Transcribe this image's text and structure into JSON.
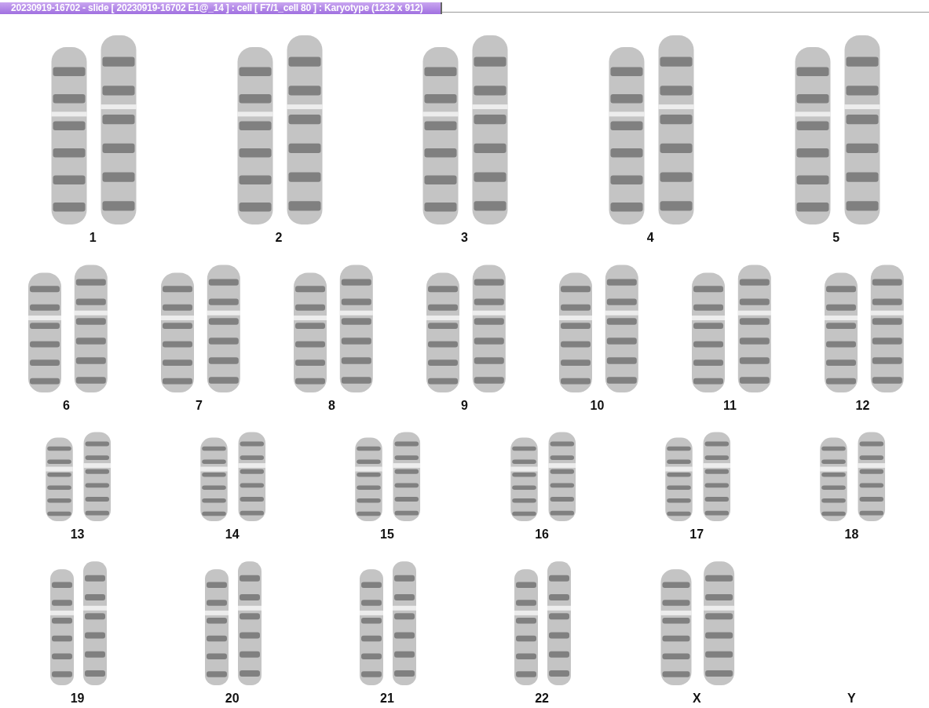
{
  "window": {
    "title": "20230919-16702 - slide [ 20230919-16702 E1@_14 ] : cell [ F7/1_cell 80 ] : Karyotype  (1232 x 912)"
  },
  "rows": [
    {
      "pairs": [
        {
          "label": "1",
          "kind": "pair"
        },
        {
          "label": "2",
          "kind": "pair"
        },
        {
          "label": "3",
          "kind": "pair"
        },
        {
          "label": "4",
          "kind": "pair"
        },
        {
          "label": "5",
          "kind": "pair"
        }
      ]
    },
    {
      "pairs": [
        {
          "label": "6",
          "kind": "pair"
        },
        {
          "label": "7",
          "kind": "pair"
        },
        {
          "label": "8",
          "kind": "pair"
        },
        {
          "label": "9",
          "kind": "pair"
        },
        {
          "label": "10",
          "kind": "pair"
        },
        {
          "label": "11",
          "kind": "pair"
        },
        {
          "label": "12",
          "kind": "pair"
        }
      ]
    },
    {
      "pairs": [
        {
          "label": "13",
          "kind": "pair"
        },
        {
          "label": "14",
          "kind": "pair"
        },
        {
          "label": "15",
          "kind": "pair"
        },
        {
          "label": "16",
          "kind": "pair"
        },
        {
          "label": "17",
          "kind": "pair"
        },
        {
          "label": "18",
          "kind": "pair"
        }
      ]
    },
    {
      "pairs": [
        {
          "label": "19",
          "kind": "pair"
        },
        {
          "label": "20",
          "kind": "pair"
        },
        {
          "label": "21",
          "kind": "pair"
        },
        {
          "label": "22",
          "kind": "pair"
        },
        {
          "label": "X",
          "kind": "pair"
        },
        {
          "label": "Y",
          "kind": "none"
        }
      ]
    }
  ]
}
